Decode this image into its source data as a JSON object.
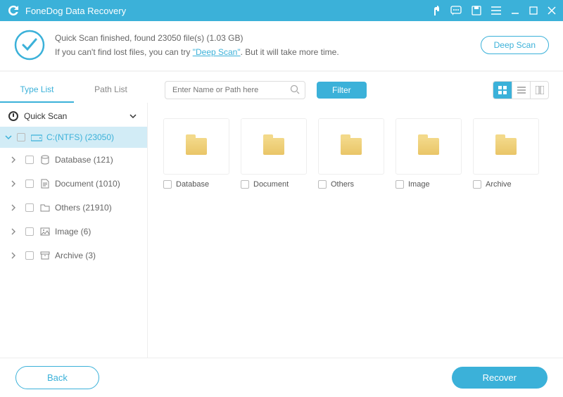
{
  "title": "FoneDog Data Recovery",
  "banner": {
    "line1_prefix": "Quick Scan finished, found ",
    "count": "23050",
    "line1_mid": " file(s) (",
    "size": "1.03 GB",
    "line1_suffix": ")",
    "line2_prefix": "If you can't find lost files, you can try ",
    "deep_link": "\"Deep Scan\"",
    "line2_suffix": ". But it will take more time.",
    "deep_scan_btn": "Deep Scan"
  },
  "tabs": {
    "type": "Type List",
    "path": "Path List"
  },
  "search": {
    "placeholder": "Enter Name or Path here"
  },
  "filter_btn": "Filter",
  "sidebar": {
    "root": "Quick Scan",
    "drive": "C:(NTFS) (23050)",
    "items": [
      {
        "label": "Database (121)"
      },
      {
        "label": "Document (1010)"
      },
      {
        "label": "Others (21910)"
      },
      {
        "label": "Image (6)"
      },
      {
        "label": "Archive (3)"
      }
    ]
  },
  "grid": [
    {
      "label": "Database"
    },
    {
      "label": "Document"
    },
    {
      "label": "Others"
    },
    {
      "label": "Image"
    },
    {
      "label": "Archive"
    }
  ],
  "footer": {
    "back": "Back",
    "recover": "Recover"
  }
}
